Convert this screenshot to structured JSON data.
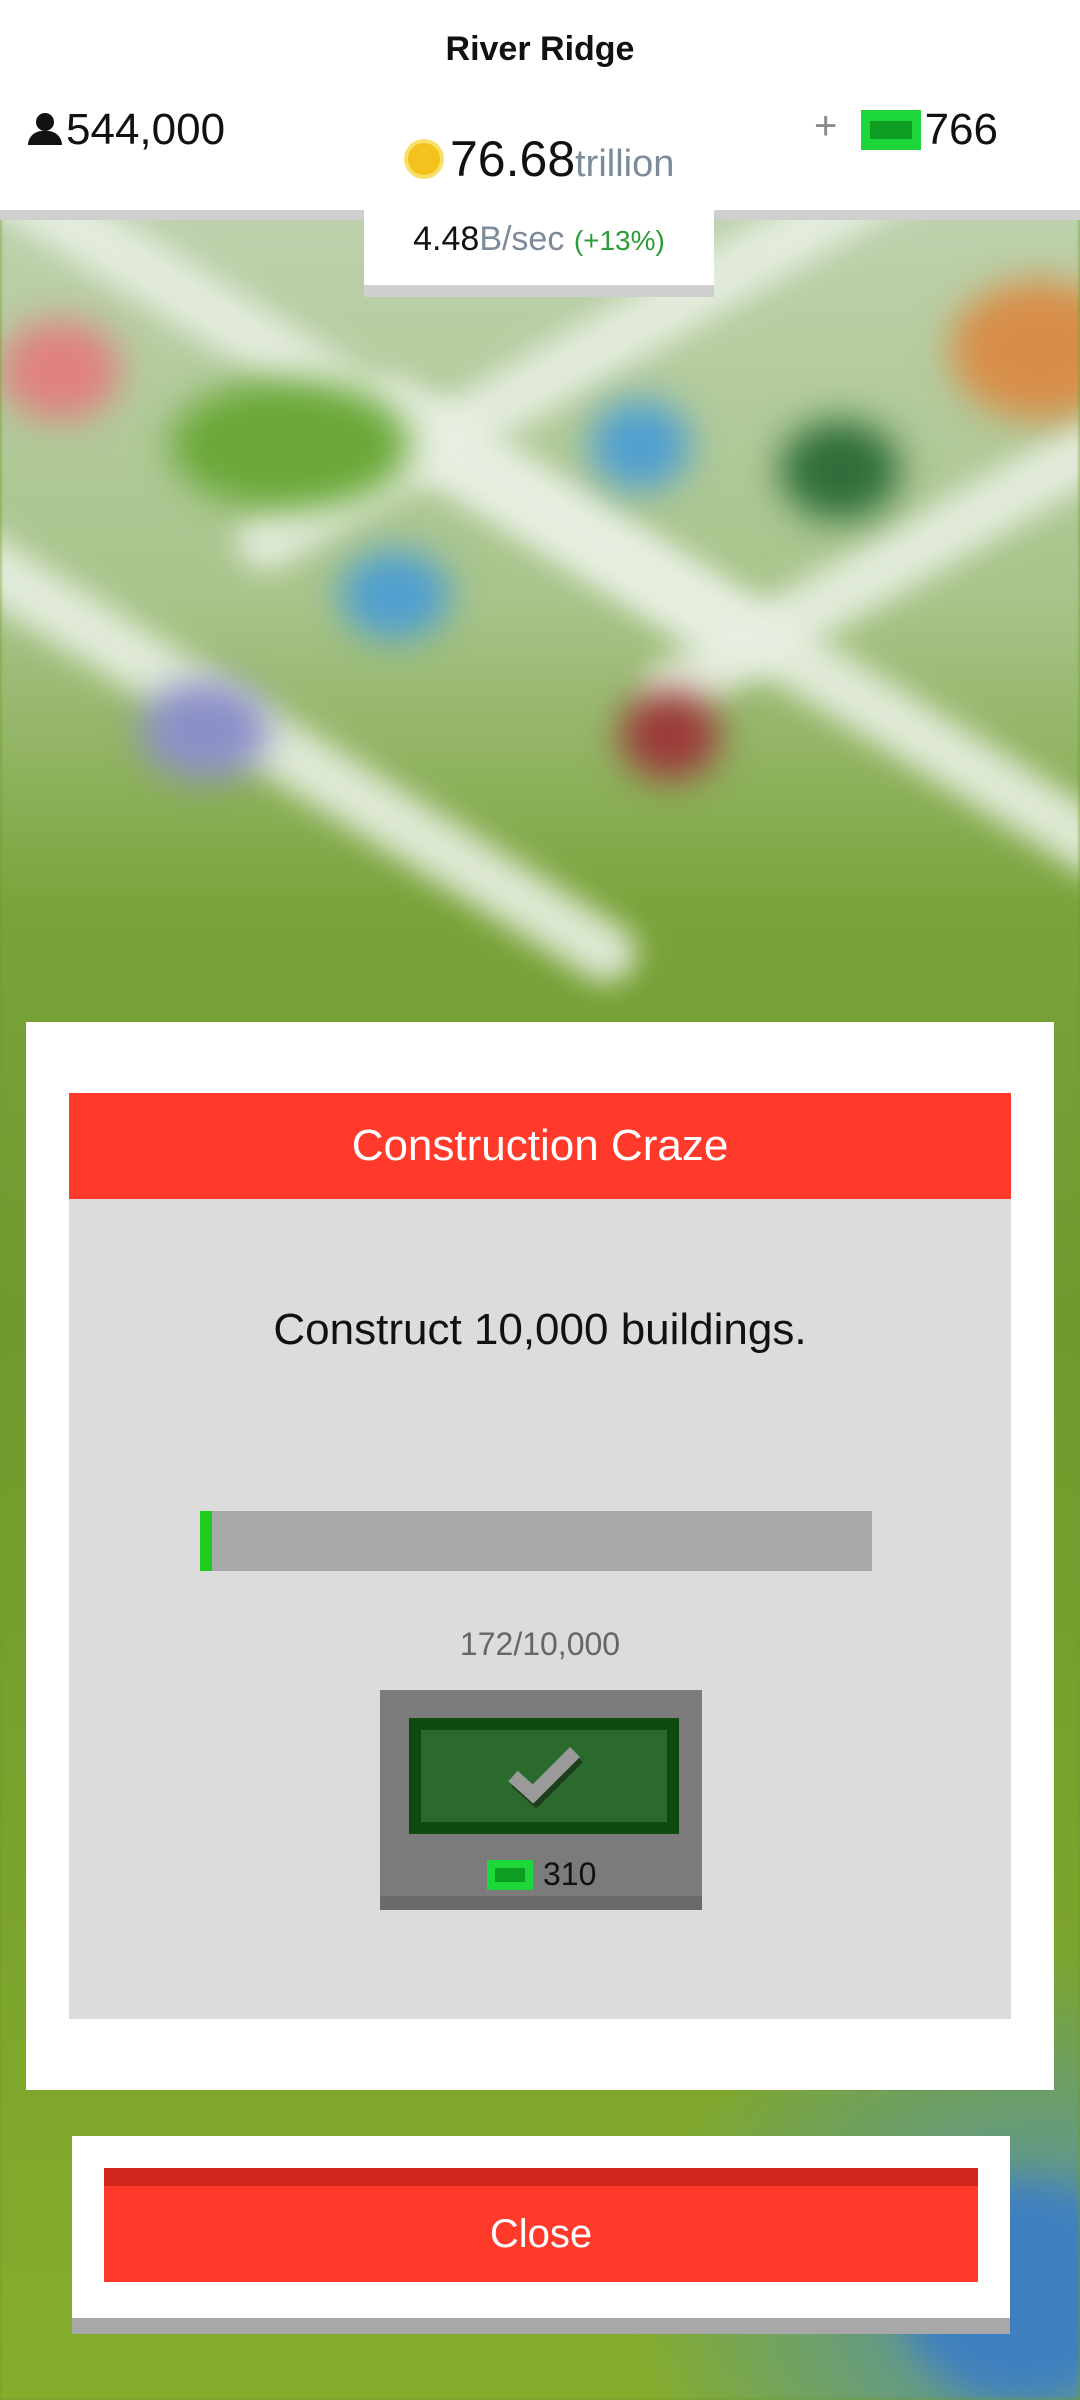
{
  "header": {
    "city_name": "River Ridge",
    "population": "544,000",
    "coins_value": "76.68",
    "coins_unit": "trillion",
    "rate_value": "4.48",
    "rate_unit": "B/sec",
    "rate_change": "(+13%)",
    "cash_plus": "+",
    "cash": "766"
  },
  "dialog": {
    "title": "Construction Craze",
    "description": "Construct 10,000 buildings.",
    "progress_text": "172/10,000",
    "progress_fraction": 0.0172,
    "reward_amount": "310",
    "close_label": "Close"
  },
  "colors": {
    "accent_red": "#ff3a2b",
    "cash_green": "#1cd63a",
    "progress_green": "#1dcc1d",
    "claim_green": "#2a6a2d"
  },
  "icons": [
    "person-icon",
    "coin-icon",
    "cash-bill-icon",
    "checkmark-icon"
  ]
}
